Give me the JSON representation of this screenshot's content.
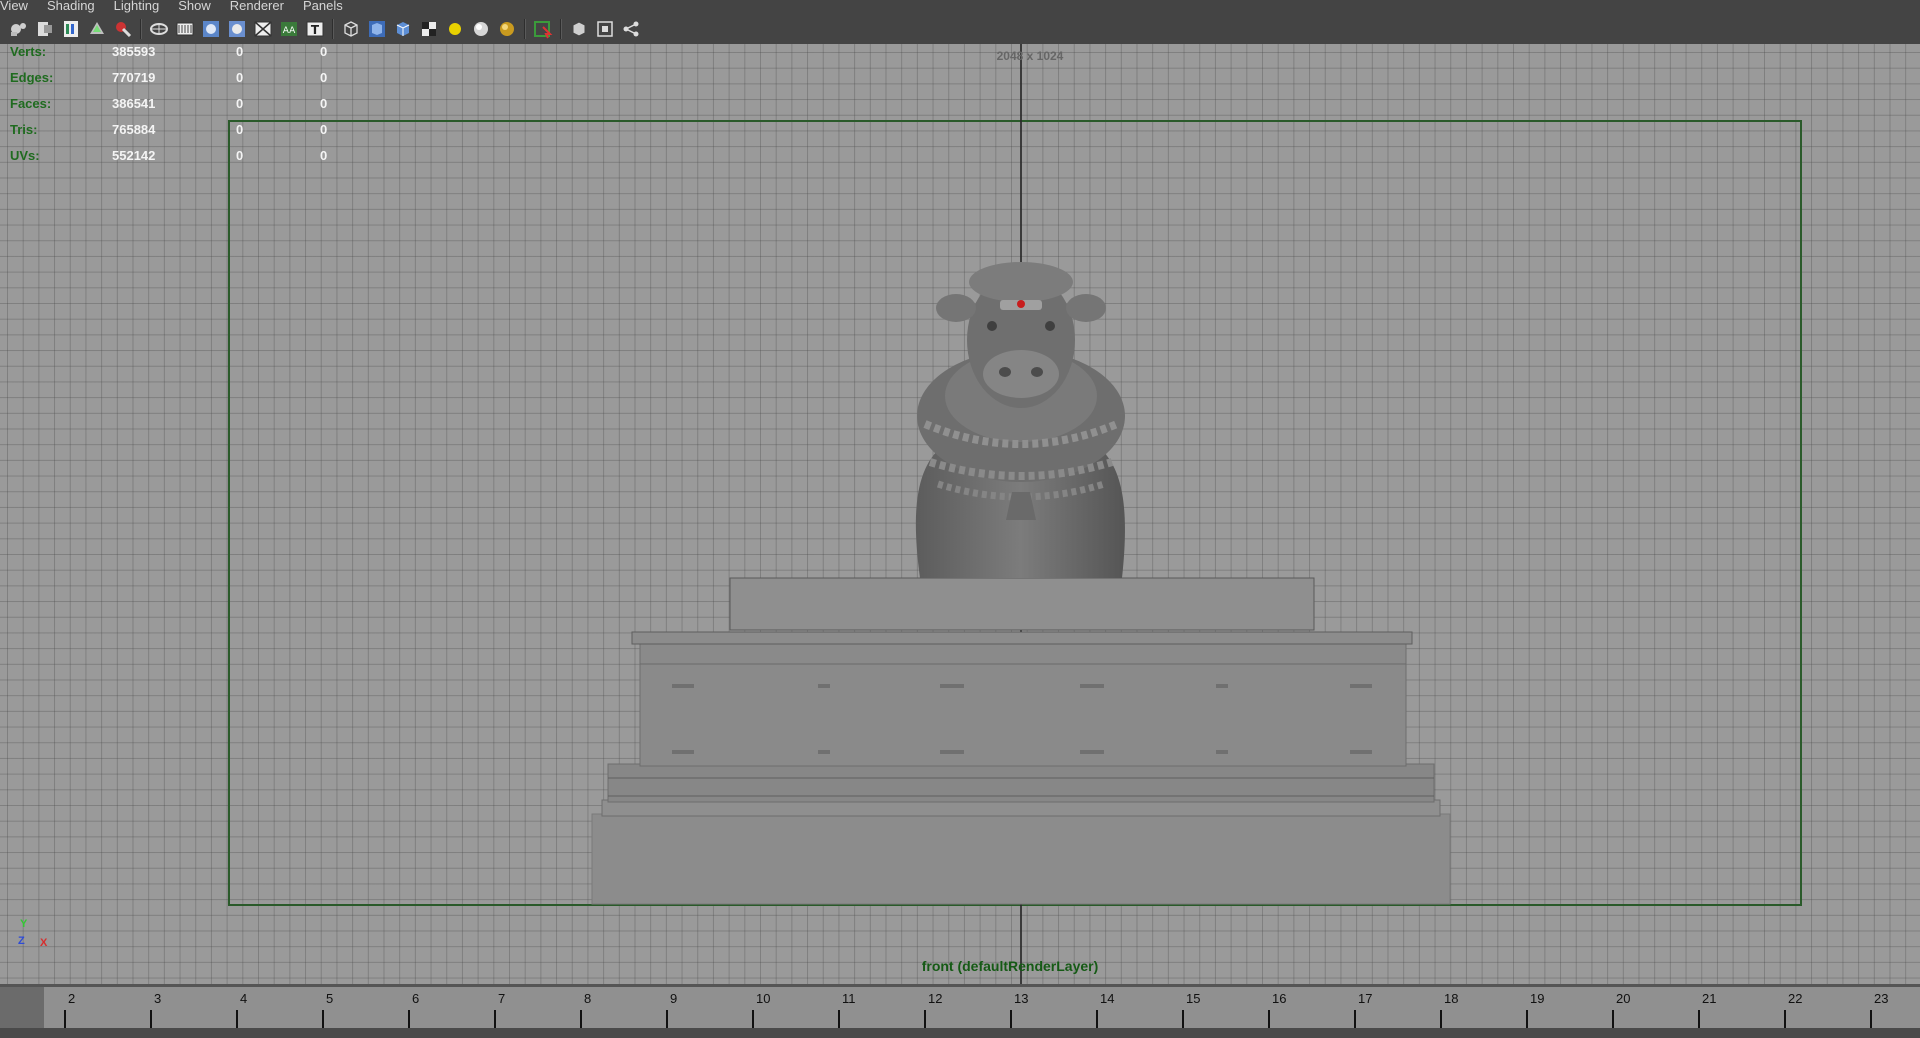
{
  "menu": [
    "View",
    "Shading",
    "Lighting",
    "Show",
    "Renderer",
    "Panels"
  ],
  "toolbar_icons": [
    "camera-attributes-icon",
    "camera-bookmarks-icon",
    "image-plane-icon",
    "two-d-pan-zoom-icon",
    "grease-pencil-icon",
    "sep",
    "grid-icon",
    "film-gate-icon",
    "resolution-gate-icon",
    "gate-mask-icon",
    "field-chart-icon",
    "safe-action-icon",
    "safe-title-icon",
    "sep",
    "wireframe-icon",
    "smooth-shade-icon",
    "wireframe-on-shaded-icon",
    "textured-icon",
    "default-light-icon",
    "all-lights-icon",
    "shadows-icon",
    "sep",
    "isolate-select-icon",
    "sep",
    "xray-icon",
    "xray-joints-icon",
    "xray-components-icon"
  ],
  "hud": {
    "rows": [
      {
        "label": "Verts:",
        "v1": "385593",
        "v2": "0",
        "v3": "0"
      },
      {
        "label": "Edges:",
        "v1": "770719",
        "v2": "0",
        "v3": "0"
      },
      {
        "label": "Faces:",
        "v1": "386541",
        "v2": "0",
        "v3": "0"
      },
      {
        "label": "Tris:",
        "v1": "765884",
        "v2": "0",
        "v3": "0"
      },
      {
        "label": "UVs:",
        "v1": "552142",
        "v2": "0",
        "v3": "0"
      }
    ]
  },
  "viewport": {
    "resolution": "2048 x 1024",
    "view_label": "front (defaultRenderLayer)",
    "axis": {
      "y": "Y",
      "z": "Z",
      "x": "X"
    }
  },
  "timeslider": {
    "ticks": [
      "2",
      "3",
      "4",
      "5",
      "6",
      "7",
      "8",
      "9",
      "10",
      "11",
      "12",
      "13",
      "14",
      "15",
      "16",
      "17",
      "18",
      "19",
      "20",
      "21",
      "22",
      "23"
    ]
  },
  "colors": {
    "hud_label": "#1f6b1f",
    "gate": "#2a5a2a",
    "viewport_bg": "#9a9a9a"
  }
}
